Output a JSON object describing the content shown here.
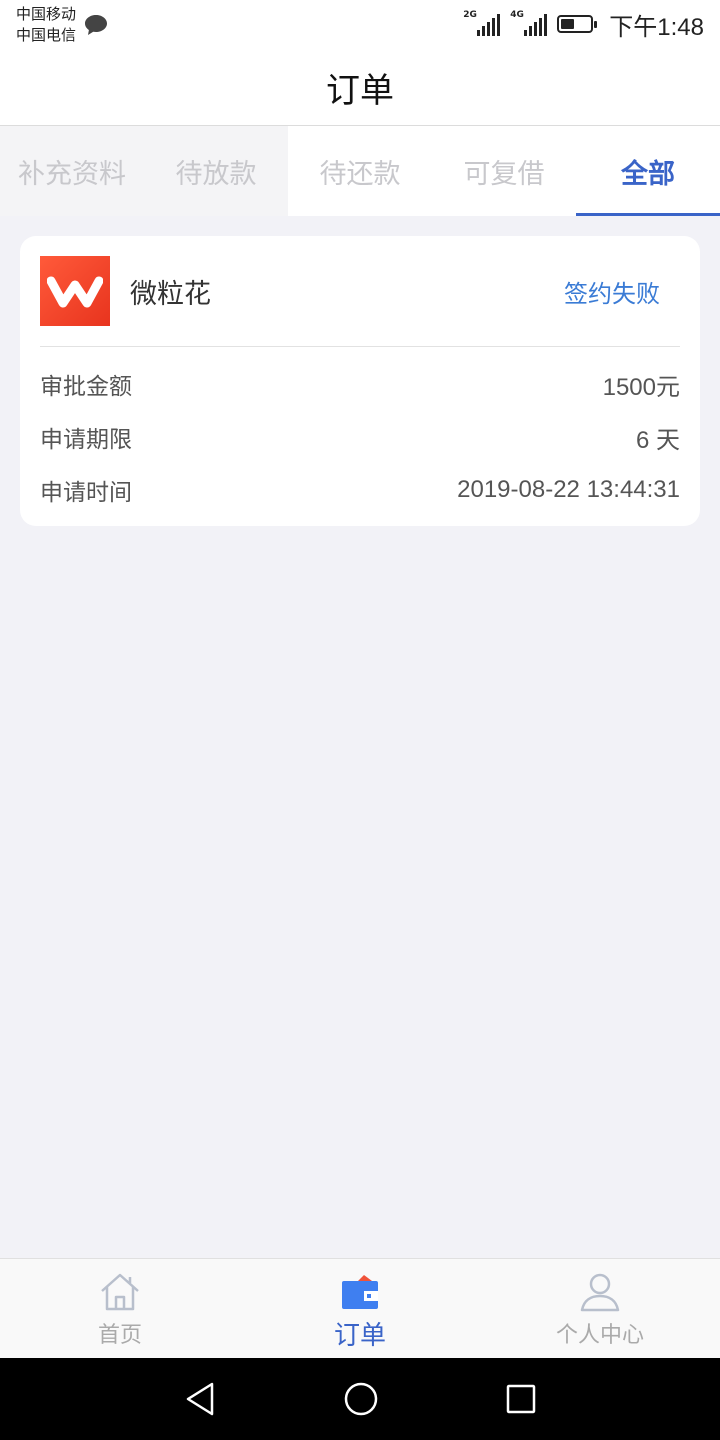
{
  "status_bar": {
    "carrier_1": "中国移动",
    "carrier_2": "中国电信",
    "net_1": "2G",
    "net_2": "4G",
    "time": "下午1:48"
  },
  "header": {
    "title": "订单"
  },
  "tabs": [
    {
      "label": "补充资料"
    },
    {
      "label": "待放款"
    },
    {
      "label": "待还款"
    },
    {
      "label": "可复借"
    },
    {
      "label": "全部",
      "active": true
    }
  ],
  "order_card": {
    "product_name": "微粒花",
    "status": "签约失败",
    "rows": [
      {
        "label": "审批金额",
        "value": "1500元"
      },
      {
        "label": "申请期限",
        "value": "6 天"
      },
      {
        "label": "申请时间",
        "value": "2019-08-22 13:44:31"
      }
    ]
  },
  "bottom_nav": [
    {
      "label": "首页",
      "icon": "home-icon"
    },
    {
      "label": "订单",
      "icon": "wallet-icon",
      "active": true
    },
    {
      "label": "个人中心",
      "icon": "user-icon"
    }
  ],
  "colors": {
    "accent": "#3a64c8",
    "status_link": "#3a7bd5",
    "background": "#f2f2f7",
    "logo": "#ef4124"
  }
}
